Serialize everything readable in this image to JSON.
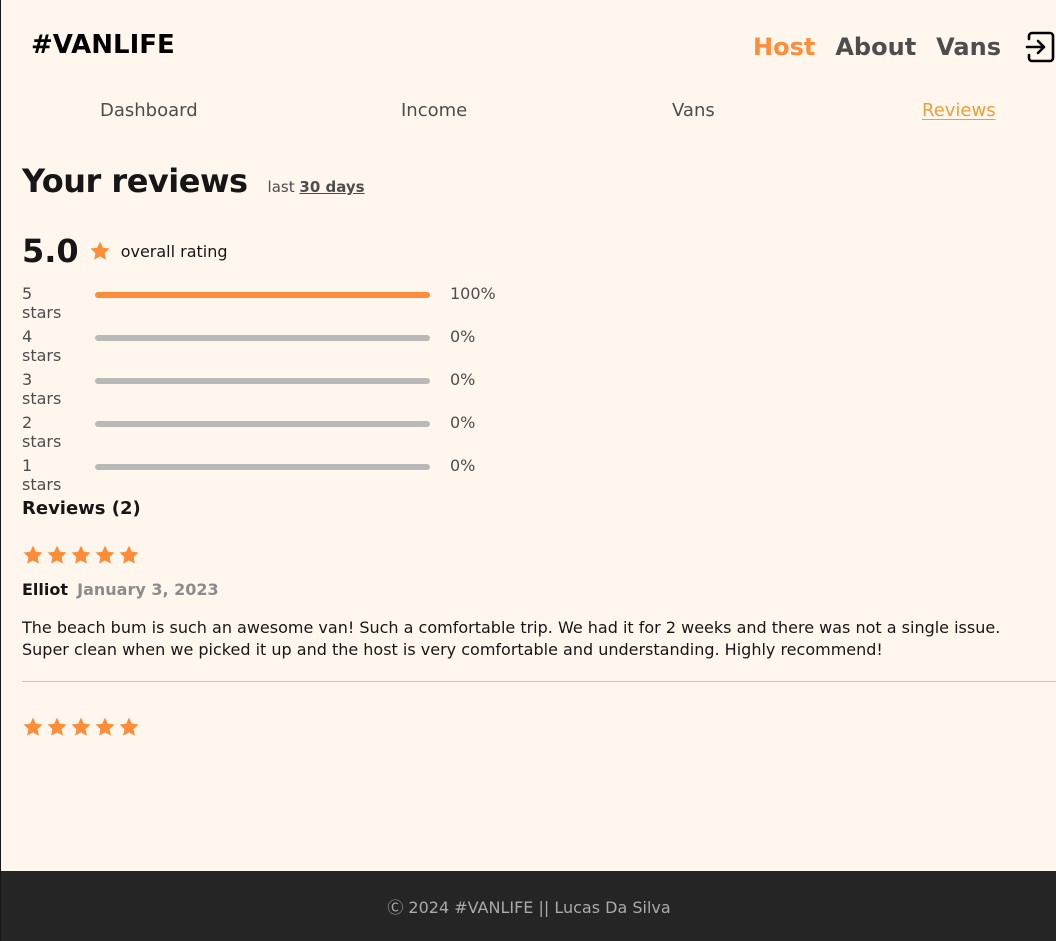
{
  "header": {
    "logo": "#VANLIFE",
    "nav": [
      {
        "label": "Host",
        "active": true
      },
      {
        "label": "About",
        "active": false
      },
      {
        "label": "Vans",
        "active": false
      }
    ],
    "login_icon": "login-icon"
  },
  "subnav": [
    {
      "label": "Dashboard",
      "active": false
    },
    {
      "label": "Income",
      "active": false
    },
    {
      "label": "Vans",
      "active": false
    },
    {
      "label": "Reviews",
      "active": true
    }
  ],
  "page": {
    "title": "Your reviews",
    "period_prefix": "last",
    "period_link": "30 days"
  },
  "rating": {
    "value": "5.0",
    "label": "overall rating",
    "star_color": "#ff8c38",
    "distribution": [
      {
        "label": "5 stars",
        "percent": "100%",
        "fraction": 1.0
      },
      {
        "label": "4 stars",
        "percent": "0%",
        "fraction": 0
      },
      {
        "label": "3 stars",
        "percent": "0%",
        "fraction": 0
      },
      {
        "label": "2 stars",
        "percent": "0%",
        "fraction": 0
      },
      {
        "label": "1 stars",
        "percent": "0%",
        "fraction": 0
      }
    ]
  },
  "reviews": {
    "heading": "Reviews (2)",
    "items": [
      {
        "stars": 5,
        "name": "Elliot",
        "date": "January 3, 2023",
        "text": "The beach bum is such an awesome van! Such a comfortable trip. We had it for 2 weeks and there was not a single issue. Super clean when we picked it up and the host is very comfortable and understanding. Highly recommend!"
      },
      {
        "stars": 5
      }
    ]
  },
  "footer": {
    "text": "Ⓒ 2024 #VANLIFE || Lucas Da Silva"
  },
  "colors": {
    "background": "#fff7ed",
    "accent": "#ff8c38",
    "footer_bg": "#252525"
  }
}
